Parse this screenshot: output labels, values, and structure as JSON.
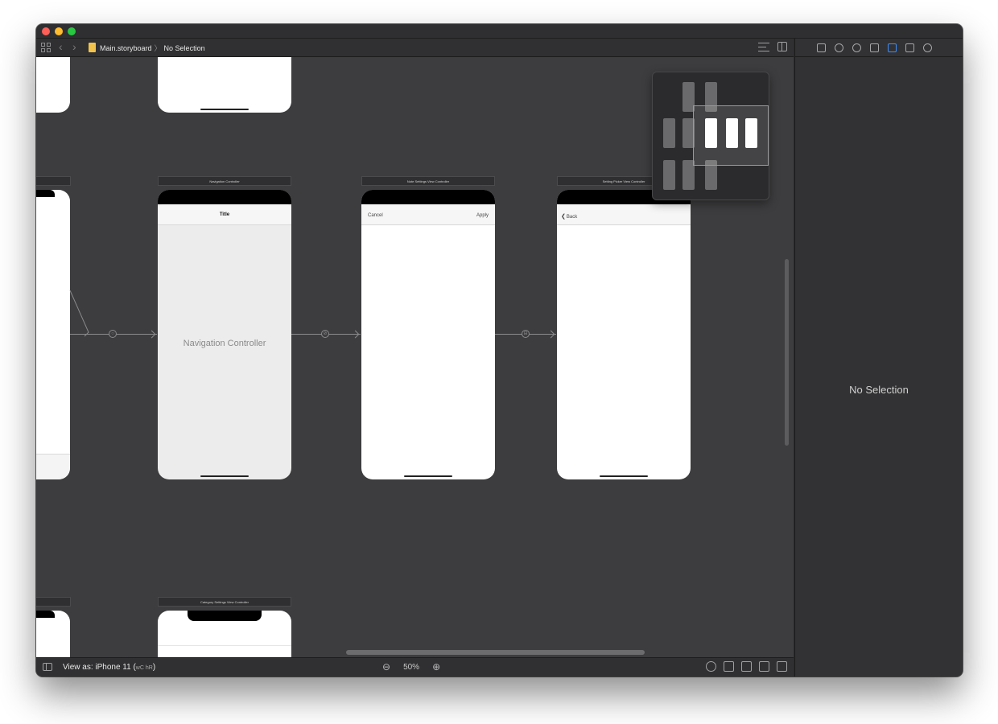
{
  "jumpbar": {
    "file": "Main.storyboard",
    "separator": "〉",
    "selection": "No Selection"
  },
  "scenes": {
    "navigation_controller": {
      "label": "Navigation Controller",
      "nav_title": "Title",
      "placeholder": "Navigation Controller"
    },
    "note_settings": {
      "label": "Note Settings View Controller",
      "left_button": "Cancel",
      "right_button": "Apply"
    },
    "setting_picker": {
      "label": "Setting Picker View Controller",
      "back_button": "Back",
      "back_chevron": "❮"
    },
    "category_settings": {
      "label": "Category Settings View Controller"
    }
  },
  "bottombar": {
    "view_as": "View as: iPhone 11 (",
    "view_as_traits": "wC hR",
    "view_as_close": ")",
    "zoom_out": "⊖",
    "zoom_level": "50%",
    "zoom_in": "⊕"
  },
  "inspector": {
    "empty_state": "No Selection"
  },
  "colors": {
    "canvas": "#3d3d3f",
    "window": "#2b2b2d",
    "inspector": "#323234",
    "accent": "#3e8ef7",
    "close": "#ff5f57",
    "minimize": "#febc2e",
    "zoom": "#28c840",
    "file_icon": "#f2c34c"
  }
}
